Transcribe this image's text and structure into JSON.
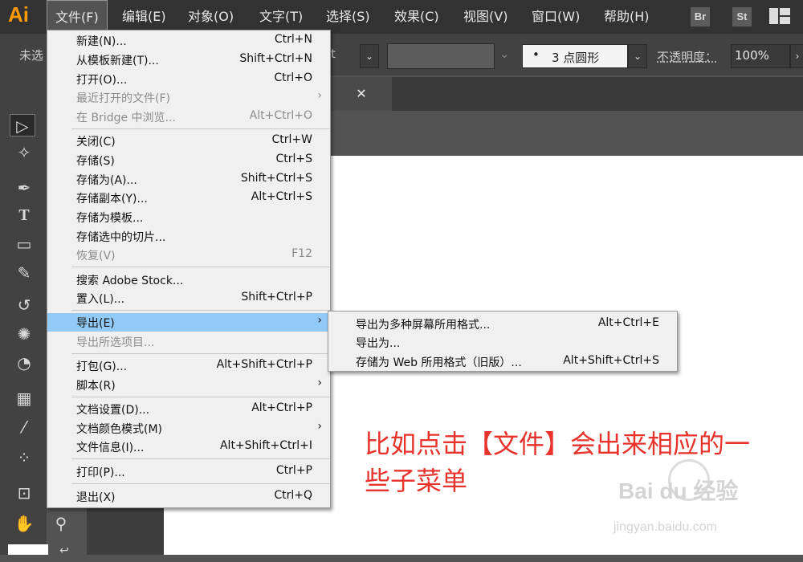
{
  "app": {
    "logo": "Ai"
  },
  "menubar": {
    "items": [
      "文件(F)",
      "编辑(E)",
      "对象(O)",
      "文字(T)",
      "选择(S)",
      "效果(C)",
      "视图(V)",
      "窗口(W)",
      "帮助(H)"
    ],
    "icons": [
      "Br",
      "St"
    ]
  },
  "control_bar": {
    "left_text": "未选",
    "font_fragment": "t",
    "stroke_profile": "3 点圆形",
    "opacity_label": "不透明度：",
    "opacity_value": "100%",
    "collapse": "‹‹"
  },
  "file_menu": {
    "items": [
      {
        "label": "新建(N)...",
        "shortcut": "Ctrl+N"
      },
      {
        "label": "从模板新建(T)...",
        "shortcut": "Shift+Ctrl+N"
      },
      {
        "label": "打开(O)...",
        "shortcut": "Ctrl+O"
      },
      {
        "label": "最近打开的文件(F)",
        "shortcut": ""
      },
      {
        "label": "在 Bridge 中浏览...",
        "shortcut": "Alt+Ctrl+O"
      },
      {
        "label": "关闭(C)",
        "shortcut": "Ctrl+W"
      },
      {
        "label": "存储(S)",
        "shortcut": "Ctrl+S"
      },
      {
        "label": "存储为(A)...",
        "shortcut": "Shift+Ctrl+S"
      },
      {
        "label": "存储副本(Y)...",
        "shortcut": "Alt+Ctrl+S"
      },
      {
        "label": "存储为模板...",
        "shortcut": ""
      },
      {
        "label": "存储选中的切片...",
        "shortcut": ""
      },
      {
        "label": "恢复(V)",
        "shortcut": "F12"
      },
      {
        "label": "搜索 Adobe Stock...",
        "shortcut": ""
      },
      {
        "label": "置入(L)...",
        "shortcut": "Shift+Ctrl+P"
      },
      {
        "label": "导出(E)",
        "shortcut": ""
      },
      {
        "label": "导出所选项目...",
        "shortcut": ""
      },
      {
        "label": "打包(G)...",
        "shortcut": "Alt+Shift+Ctrl+P"
      },
      {
        "label": "脚本(R)",
        "shortcut": ""
      },
      {
        "label": "文档设置(D)...",
        "shortcut": "Alt+Ctrl+P"
      },
      {
        "label": "文档颜色模式(M)",
        "shortcut": ""
      },
      {
        "label": "文件信息(I)...",
        "shortcut": "Alt+Shift+Ctrl+I"
      },
      {
        "label": "打印(P)...",
        "shortcut": "Ctrl+P"
      },
      {
        "label": "退出(X)",
        "shortcut": "Ctrl+Q"
      }
    ]
  },
  "export_submenu": {
    "items": [
      {
        "label": "导出为多种屏幕所用格式...",
        "shortcut": "Alt+Ctrl+E"
      },
      {
        "label": "导出为...",
        "shortcut": ""
      },
      {
        "label": "存储为 Web 所用格式（旧版）...",
        "shortcut": "Alt+Shift+Ctrl+S"
      }
    ]
  },
  "annotation": {
    "line1": "比如点击【文件】会出来相应的一",
    "line2": "些子菜单"
  },
  "watermark": {
    "brand": "Bai du 经验",
    "url": "jingyan.baidu.com"
  }
}
